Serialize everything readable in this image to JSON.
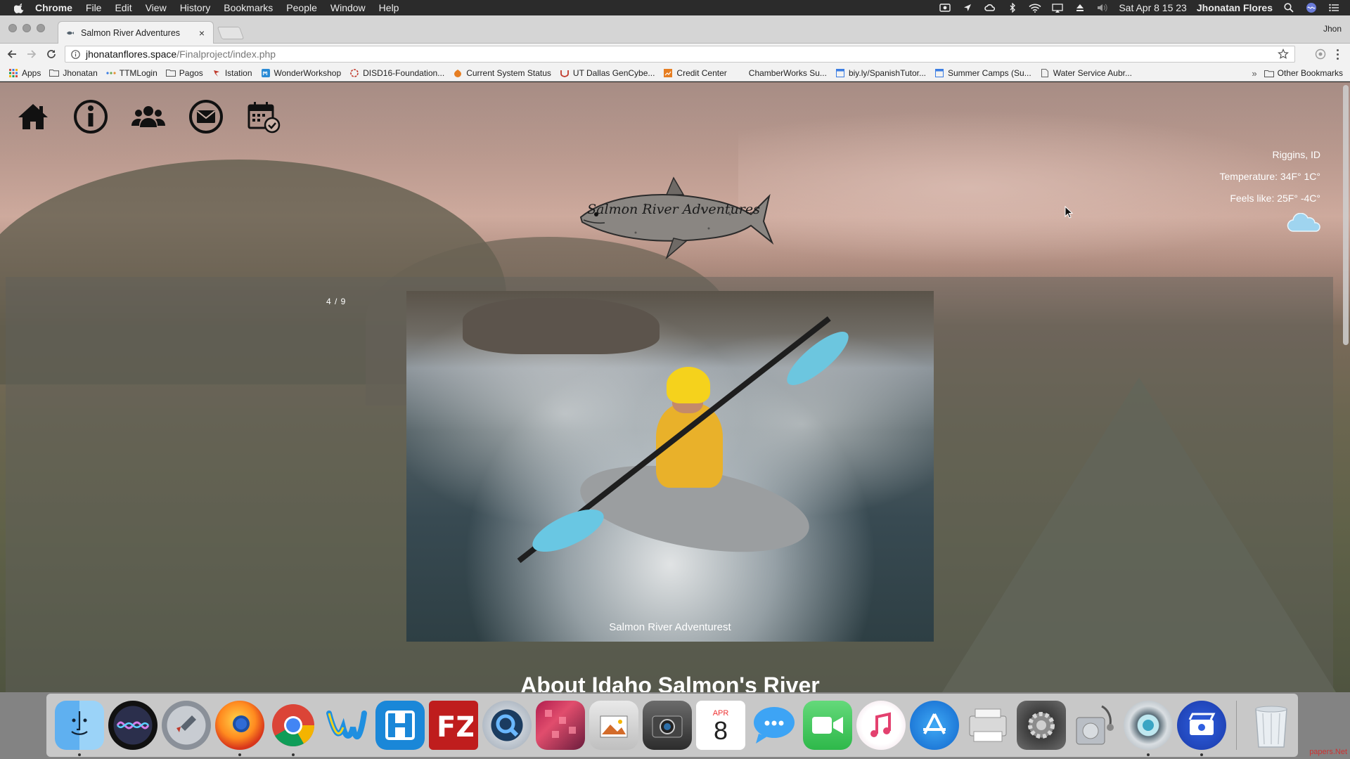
{
  "menubar": {
    "app_name": "Chrome",
    "items": [
      "File",
      "Edit",
      "View",
      "History",
      "Bookmarks",
      "People",
      "Window",
      "Help"
    ],
    "datetime": "Sat Apr 8  15 23",
    "user": "Jhonatan Flores"
  },
  "browser": {
    "tab_title": "Salmon River Adventures",
    "profile_name": "Jhon",
    "url_host": "jhonatanflores.space",
    "url_path": "/Finalproject/index.php"
  },
  "bookmarks": {
    "items": [
      {
        "label": "Apps",
        "icon": "apps-grid-icon"
      },
      {
        "label": "Jhonatan",
        "icon": "folder-icon"
      },
      {
        "label": "TTMLogin",
        "icon": "dots-icon"
      },
      {
        "label": "Pagos",
        "icon": "folder-icon"
      },
      {
        "label": "Istation",
        "icon": "istation-icon"
      },
      {
        "label": "WonderWorkshop",
        "icon": "wonder-icon"
      },
      {
        "label": "DISD16-Foundation...",
        "icon": "disd-icon"
      },
      {
        "label": "Current System Status",
        "icon": "status-icon"
      },
      {
        "label": "UT Dallas GenCybe...",
        "icon": "utd-icon"
      },
      {
        "label": "Credit Center",
        "icon": "credit-icon"
      },
      {
        "label": "ChamberWorks Su...",
        "icon": "blank-icon"
      },
      {
        "label": "biy.ly/SpanishTutor...",
        "icon": "page-icon"
      },
      {
        "label": "Summer Camps (Su...",
        "icon": "page-icon"
      },
      {
        "label": "Water Service Aubr...",
        "icon": "doc-icon"
      }
    ],
    "more": "»",
    "other": "Other Bookmarks"
  },
  "site": {
    "nav_icons": [
      "home-icon",
      "info-icon",
      "group-icon",
      "mail-icon",
      "calendar-check-icon"
    ],
    "logo_text": "Salmon River Adventures",
    "weather": {
      "location": "Riggins, ID",
      "temperature": "Temperature: 34F° 1C°",
      "feels_like": "Feels like: 25F° -4C°",
      "icon": "cloud-icon"
    },
    "slider": {
      "counter": "4 / 9",
      "caption": "Salmon River Adventurest"
    },
    "section_heading": "About Idaho Salmon's River"
  },
  "dock": {
    "apps": [
      "finder-icon",
      "siri-icon",
      "launchpad-icon",
      "firefox-icon",
      "chrome-icon",
      "wonder-app-icon",
      "remote-app-icon",
      "filezilla-icon",
      "quicktime-icon",
      "pixel-app-icon",
      "preview-icon",
      "image-capture-icon",
      "calendar-icon",
      "messages-icon",
      "facetime-icon",
      "itunes-icon",
      "app-store-icon",
      "printer-icon",
      "system-preferences-icon",
      "disk-utility-icon",
      "photo-booth-icon",
      "screencast-icon"
    ],
    "calendar_month": "APR",
    "calendar_day": "8",
    "watermark": "papers.Net"
  }
}
